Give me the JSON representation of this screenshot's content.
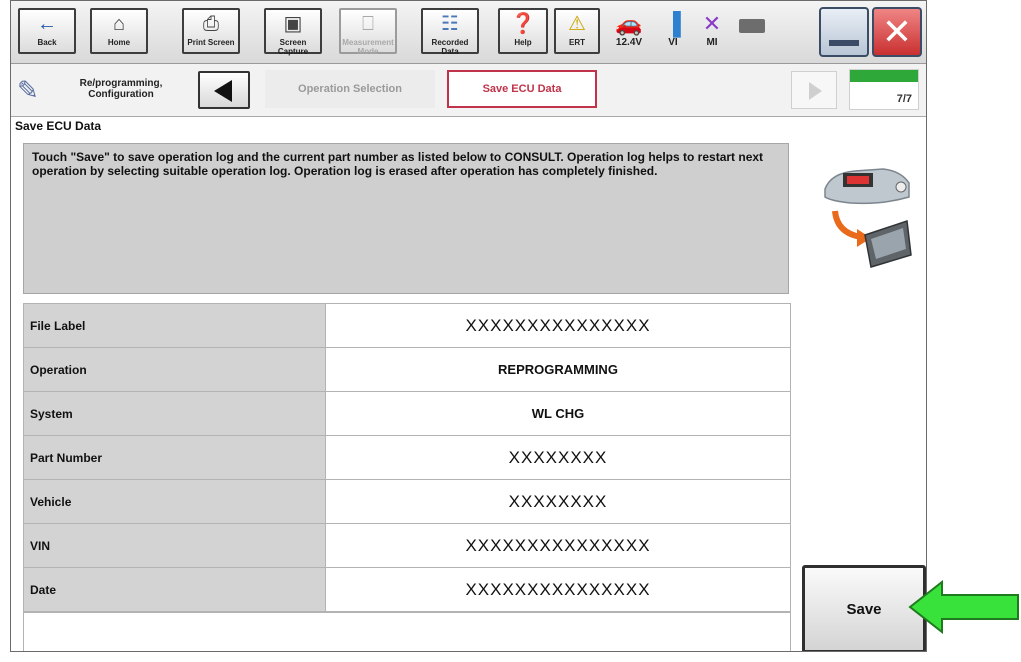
{
  "toolbar": {
    "back_label": "Back",
    "home_label": "Home",
    "print_label": "Print Screen",
    "capture_label": "Screen Capture",
    "measurement_label": "Measurement Mode",
    "recorded_label": "Recorded Data",
    "help_label": "Help",
    "ert_label": "ERT",
    "battery_voltage": "12.4V",
    "vi_label": "VI",
    "mi_label": "MI"
  },
  "nav": {
    "section_label": "Re/programming, Configuration",
    "step_operation": "Operation Selection",
    "step_current": "Save ECU Data",
    "progress": "7/7"
  },
  "page_title": "Save ECU Data",
  "message": "Touch \"Save\" to save operation log and the current part number as listed below to CONSULT. Operation log helps to restart next operation by selecting suitable operation log. Operation log is erased after operation has completely finished.",
  "rows": [
    {
      "label": "File Label",
      "value": "XXXXXXXXXXXXXXX"
    },
    {
      "label": "Operation",
      "value": "REPROGRAMMING"
    },
    {
      "label": "System",
      "value": "WL CHG"
    },
    {
      "label": "Part Number",
      "value": "XXXXXXXX"
    },
    {
      "label": "Vehicle",
      "value": "XXXXXXXX"
    },
    {
      "label": "VIN",
      "value": "XXXXXXXXXXXXXXX"
    },
    {
      "label": "Date",
      "value": "XXXXXXXXXXXXXXX"
    }
  ],
  "save_label": "Save",
  "colors": {
    "current_step_border": "#c0334a",
    "progress_fill": "#2fa83a",
    "arrow_fill": "#39e23a",
    "close_red": "#d63a3a"
  }
}
